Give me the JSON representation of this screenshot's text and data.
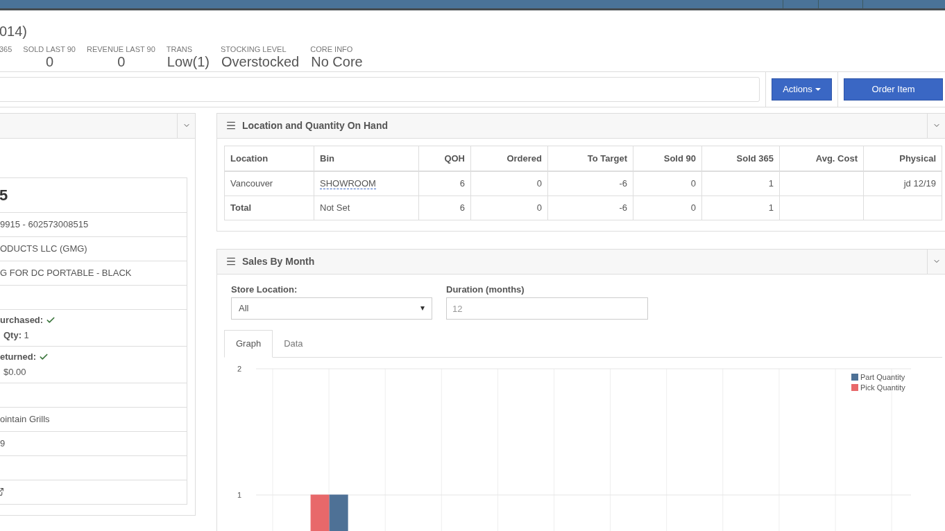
{
  "title": "014)",
  "stats": [
    {
      "label": "365"
    },
    {
      "label": "SOLD LAST 90",
      "value": "0"
    },
    {
      "label": "REVENUE LAST 90",
      "value": "0"
    },
    {
      "label": "TRANS",
      "value": "Low(1)"
    },
    {
      "label": "STOCKING LEVEL",
      "value": "Overstocked"
    },
    {
      "label": "CORE INFO",
      "value": "No Core"
    }
  ],
  "actions": [
    {
      "label": "Actions",
      "kind": "dropdown"
    },
    {
      "label": "Order Item",
      "kind": "plain"
    }
  ],
  "details": [
    {
      "kind": "title",
      "text": "5"
    },
    {
      "kind": "text",
      "text": "9915 - 602573008515"
    },
    {
      "kind": "text",
      "text": "ODUCTS LLC (GMG)"
    },
    {
      "kind": "text",
      "text": "G FOR DC PORTABLE - BLACK"
    },
    {
      "kind": "empty"
    },
    {
      "kind": "check",
      "text": "urchased:",
      "checked": true,
      "sub": "**Qty:** 1"
    },
    {
      "kind": "check",
      "text": "eturned:",
      "checked": true,
      "sub": "$0.00"
    },
    {
      "kind": "empty"
    },
    {
      "kind": "text",
      "text": "ointain Grills"
    },
    {
      "kind": "text",
      "text": "9"
    },
    {
      "kind": "empty"
    },
    {
      "kind": "icon"
    }
  ],
  "location_panel": {
    "title": "Location and Quantity On Hand",
    "columns": [
      "Location",
      "Bin",
      "QOH",
      "Ordered",
      "To Target",
      "Sold 90",
      "Sold 365",
      "Avg. Cost",
      "Physical"
    ],
    "rows": [
      {
        "kind": "normal",
        "cells": [
          "Vancouver",
          "SHOWROOM",
          "6",
          "0",
          "-6",
          "0",
          "1",
          "",
          "jd 12/19"
        ]
      },
      {
        "kind": "total",
        "cells": [
          "Total",
          "Not Set",
          "6",
          "0",
          "-6",
          "0",
          "1",
          "",
          ""
        ]
      }
    ]
  },
  "sales_panel": {
    "title": "Sales By Month",
    "store_location": {
      "label": "Store Location:",
      "value": "All"
    },
    "duration": {
      "label": "Duration (months)",
      "placeholder": "12"
    },
    "tabs": [
      {
        "label": "Graph",
        "selected": true
      },
      {
        "label": "Data",
        "selected": false
      }
    ],
    "chart_data": {
      "type": "bar",
      "ylim": [
        0,
        2
      ],
      "yticks": [
        1,
        2
      ],
      "legend": "top-right",
      "grid": true,
      "series": [
        {
          "name": "Pick Quantity",
          "color": "#e8686a",
          "values": [
            null,
            1,
            null,
            null,
            null,
            null,
            null,
            null,
            null,
            null,
            null,
            null
          ]
        },
        {
          "name": "Part Quantity",
          "color": "#4e7196",
          "values": [
            null,
            1,
            null,
            null,
            null,
            null,
            null,
            null,
            null,
            null,
            null,
            null
          ]
        }
      ]
    }
  }
}
